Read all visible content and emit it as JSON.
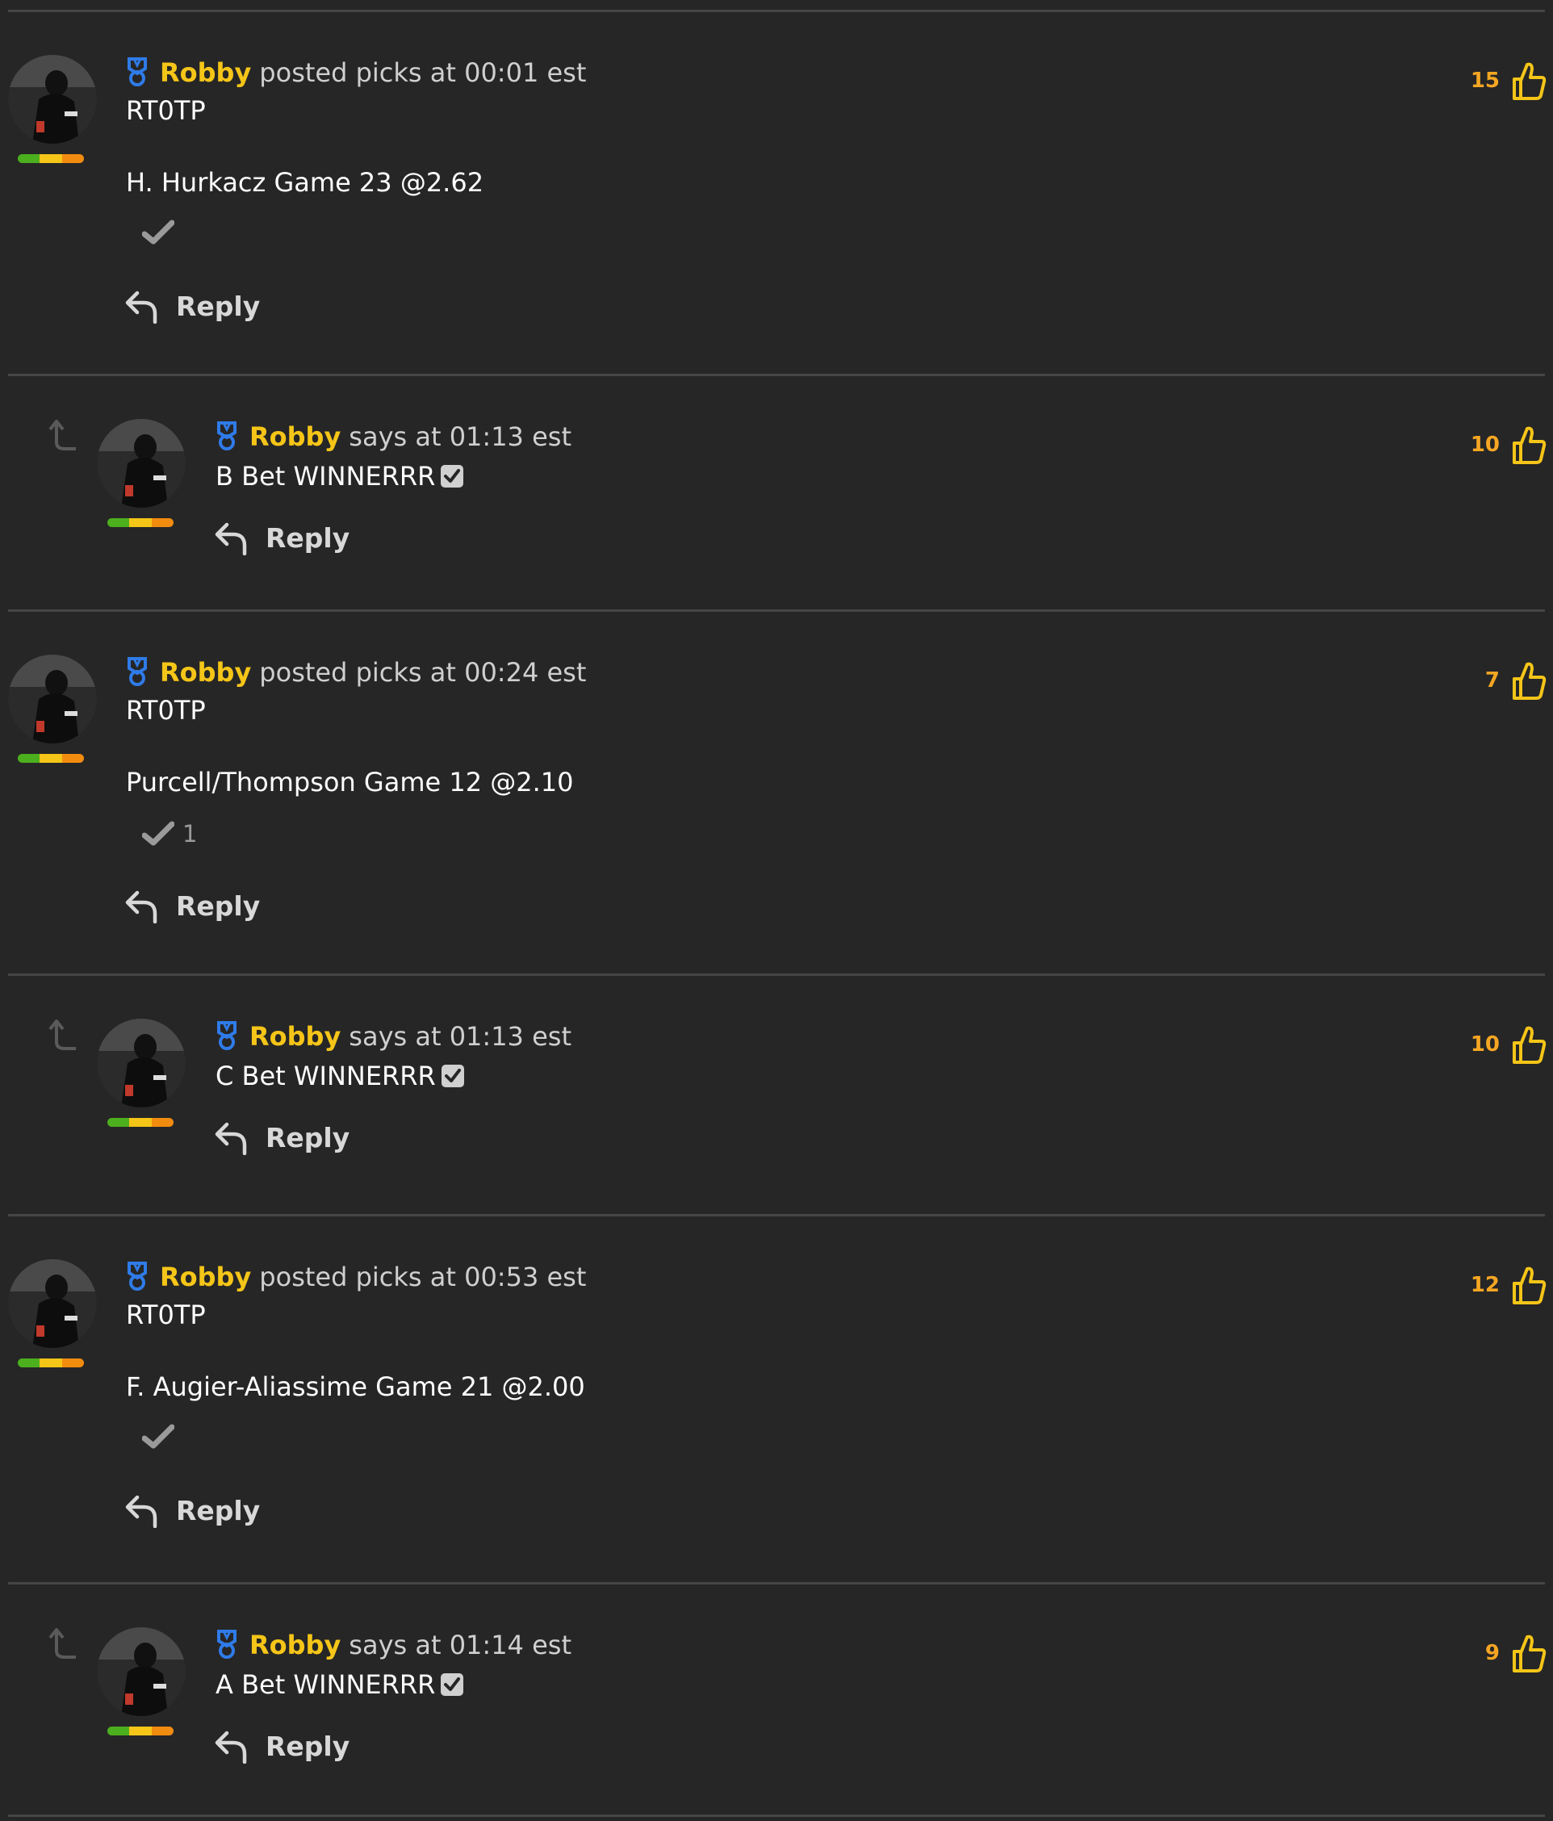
{
  "colors": {
    "background": "#262626",
    "author": "#f5c518",
    "like_count": "#f5a623",
    "badge": "#2f7be8",
    "rating_bar": [
      "#4caf1e",
      "#f5c518",
      "#f28c0f"
    ]
  },
  "posts": [
    {
      "author": "Robby",
      "action": "posted picks at 00:01 est",
      "title": "RT0TP",
      "pick": "H. Hurkacz Game 23 @2.62",
      "tick_count": "",
      "reply_label": "Reply",
      "likes": "15",
      "reply": {
        "author": "Robby",
        "action": "says at 01:13 est",
        "text": "B Bet WINNERRR",
        "reply_label": "Reply",
        "likes": "10"
      }
    },
    {
      "author": "Robby",
      "action": "posted picks at 00:24 est",
      "title": "RT0TP",
      "pick": "Purcell/Thompson Game 12 @2.10",
      "tick_count": "1",
      "reply_label": "Reply",
      "likes": "7",
      "reply": {
        "author": "Robby",
        "action": "says at 01:13 est",
        "text": "C Bet WINNERRR",
        "reply_label": "Reply",
        "likes": "10"
      }
    },
    {
      "author": "Robby",
      "action": "posted picks at 00:53 est",
      "title": "RT0TP",
      "pick": "F. Augier-Aliassime Game 21 @2.00",
      "tick_count": "",
      "reply_label": "Reply",
      "likes": "12",
      "reply": {
        "author": "Robby",
        "action": "says at 01:14 est",
        "text": "A Bet WINNERRR",
        "reply_label": "Reply",
        "likes": "9"
      }
    }
  ]
}
